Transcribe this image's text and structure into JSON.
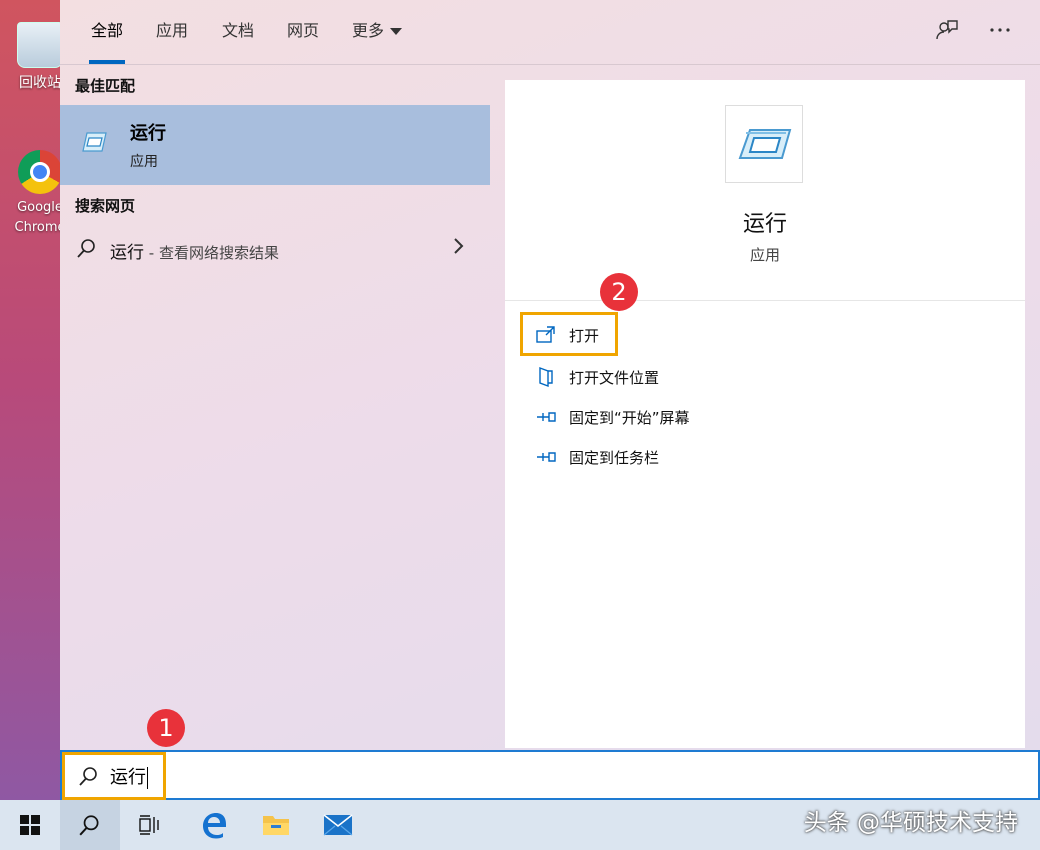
{
  "desktop": {
    "icons": [
      {
        "label": "回收站"
      },
      {
        "label": "Google Chrome"
      }
    ]
  },
  "tabs": [
    {
      "label": "全部"
    },
    {
      "label": "应用"
    },
    {
      "label": "文档"
    },
    {
      "label": "网页"
    },
    {
      "label": "更多"
    }
  ],
  "toolbar": {
    "feedback_icon": "feedback-icon",
    "more_icon": "ellipsis-icon"
  },
  "left": {
    "best_match_heading": "最佳匹配",
    "best_match": {
      "name": "运行",
      "type": "应用"
    },
    "web_heading": "搜索网页",
    "web_result": {
      "query": "运行",
      "hint": " - 查看网络搜索结果"
    }
  },
  "right": {
    "app_name": "运行",
    "app_type": "应用",
    "actions": [
      {
        "label": "打开",
        "icon": "open-icon"
      },
      {
        "label": "打开文件位置",
        "icon": "file-location-icon"
      },
      {
        "label": "固定到“开始”屏幕",
        "icon": "pin-icon"
      },
      {
        "label": "固定到任务栏",
        "icon": "pin-icon"
      }
    ]
  },
  "search": {
    "value": "运行"
  },
  "badges": {
    "one": "1",
    "two": "2"
  },
  "watermark": "头条 @华硕技术支持",
  "colors": {
    "accent": "#0067c0",
    "highlight": "#f0a500",
    "badge": "#e8323a",
    "selected": "#a8bedd"
  }
}
